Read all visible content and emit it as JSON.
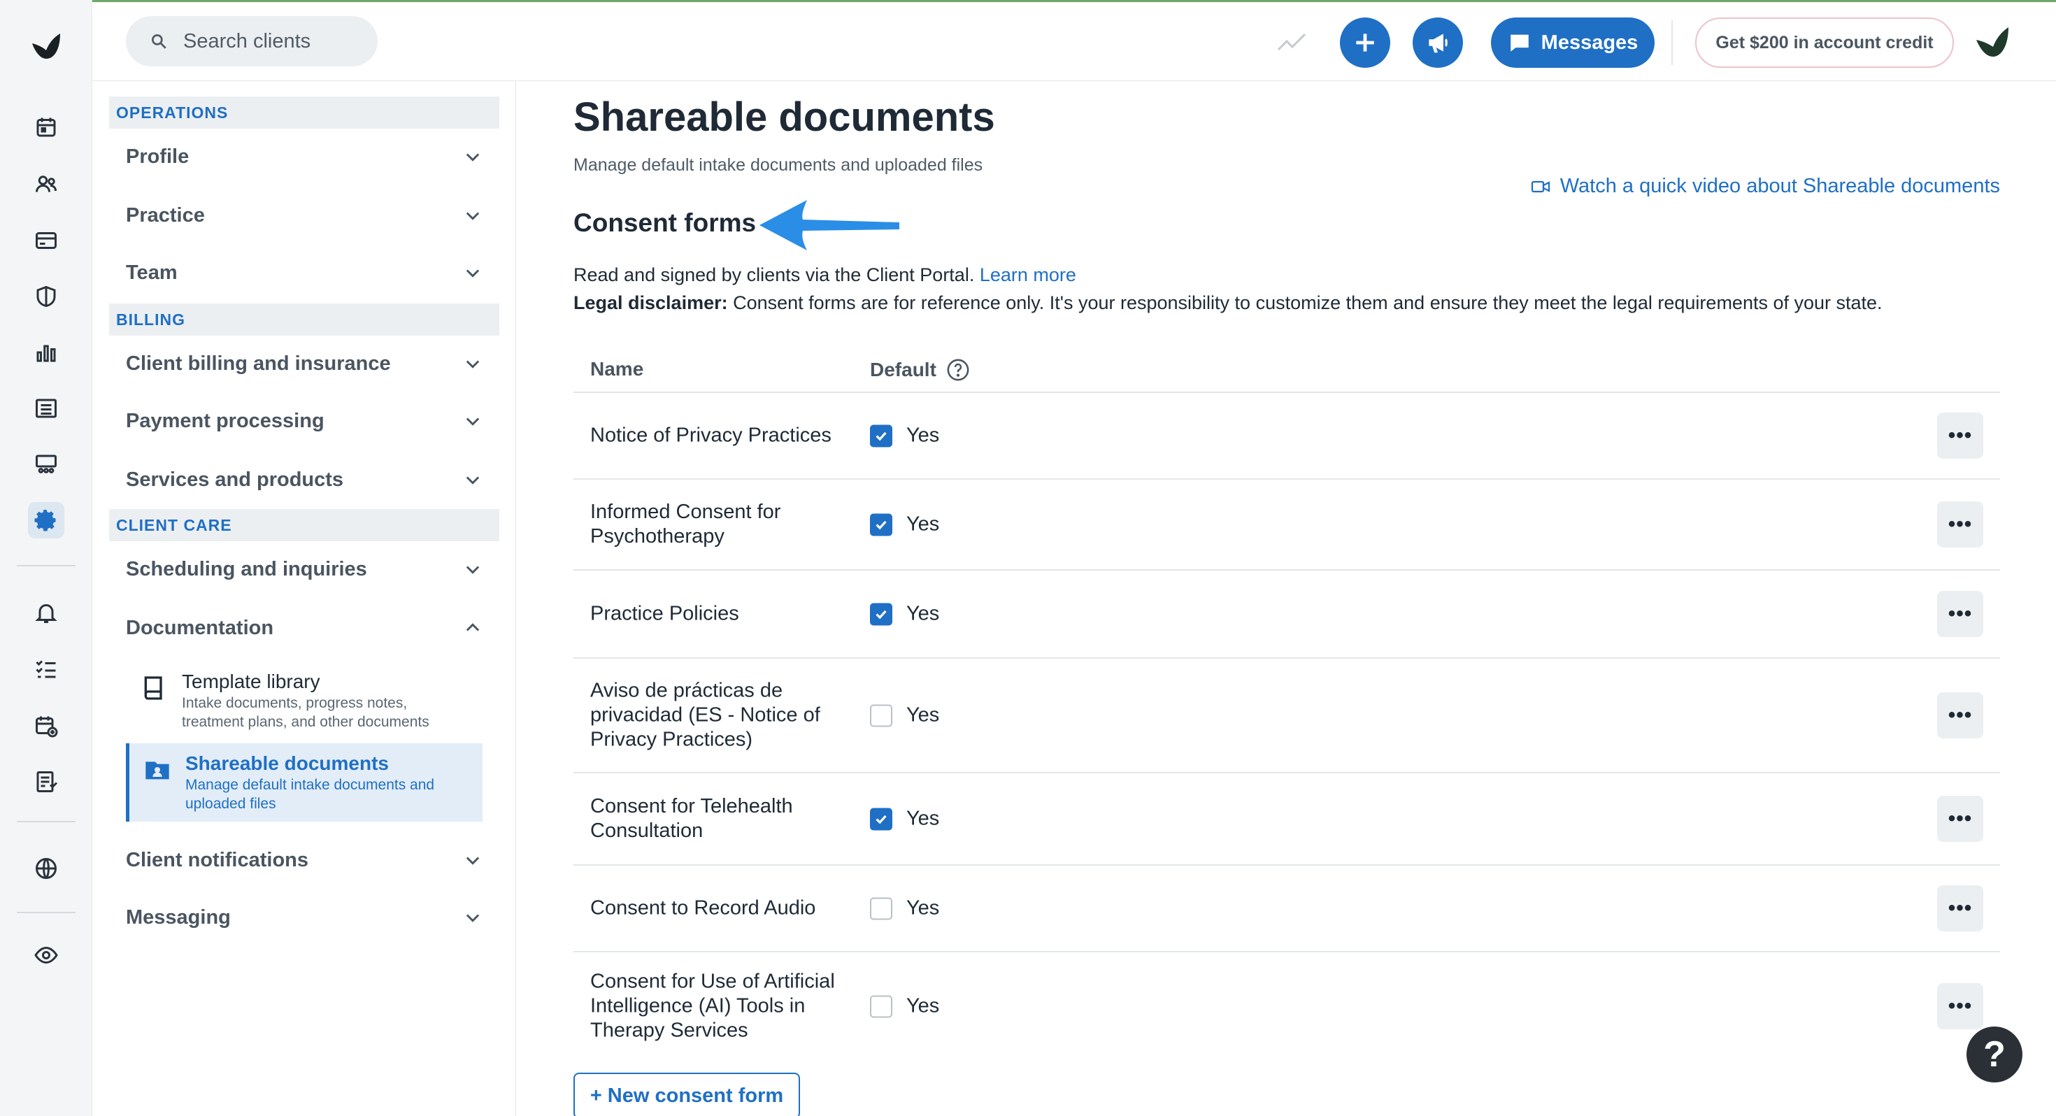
{
  "topbar": {
    "search_placeholder": "Search clients",
    "messages_label": "Messages",
    "credit_label": "Get $200 in account credit"
  },
  "rail": {
    "icons": [
      "calendar-icon",
      "clients-icon",
      "billing-card-icon",
      "shield-icon",
      "analytics-icon",
      "list-icon",
      "marketplace-icon",
      "settings-gear-icon",
      "bell-icon",
      "tasks-icon",
      "calendar-add-icon",
      "reports-icon",
      "globe-icon",
      "eye-icon"
    ],
    "active": "settings-gear-icon"
  },
  "subnav": {
    "sections": {
      "operations": "OPERATIONS",
      "billing": "BILLING",
      "client_care": "CLIENT CARE"
    },
    "items": {
      "profile": "Profile",
      "practice": "Practice",
      "team": "Team",
      "client_billing": "Client billing and insurance",
      "payment_processing": "Payment processing",
      "services_products": "Services and products",
      "scheduling": "Scheduling and inquiries",
      "documentation": "Documentation",
      "client_notifications": "Client notifications",
      "messaging": "Messaging"
    },
    "documentation_sub": [
      {
        "title": "Template library",
        "desc": "Intake documents, progress notes, treatment plans, and other documents"
      },
      {
        "title": "Shareable documents",
        "desc": "Manage default intake documents and uploaded files"
      }
    ]
  },
  "main": {
    "title": "Shareable documents",
    "subtitle": "Manage default intake documents and uploaded files",
    "video_link": "Watch a quick video about Shareable documents",
    "section_title": "Consent forms",
    "desc_text": "Read and signed by clients via the Client Portal.",
    "learn_more": "Learn more",
    "disclaimer_label": "Legal disclaimer:",
    "disclaimer_text": "Consent forms are for reference only. It's your responsibility to customize them and ensure they meet the legal requirements of your state.",
    "col_name": "Name",
    "col_default": "Default",
    "rows": [
      {
        "name": "Notice of Privacy Practices",
        "default": true,
        "default_label": "Yes"
      },
      {
        "name": "Informed Consent for Psychotherapy",
        "default": true,
        "default_label": "Yes"
      },
      {
        "name": "Practice Policies",
        "default": true,
        "default_label": "Yes"
      },
      {
        "name": "Aviso de prácticas de privacidad (ES - Notice of Privacy Practices)",
        "default": false,
        "default_label": "Yes"
      },
      {
        "name": "Consent for Telehealth Consultation",
        "default": true,
        "default_label": "Yes"
      },
      {
        "name": "Consent to Record Audio",
        "default": false,
        "default_label": "Yes"
      },
      {
        "name": "Consent for Use of Artificial Intelligence (AI) Tools in Therapy Services",
        "default": false,
        "default_label": "Yes"
      }
    ],
    "more_label": "•••",
    "new_button": "+ New consent form"
  },
  "help_label": "?",
  "colors": {
    "accent": "#1f6fc5",
    "active_bg": "#e3edf7",
    "arrow": "#2a8ee6"
  }
}
